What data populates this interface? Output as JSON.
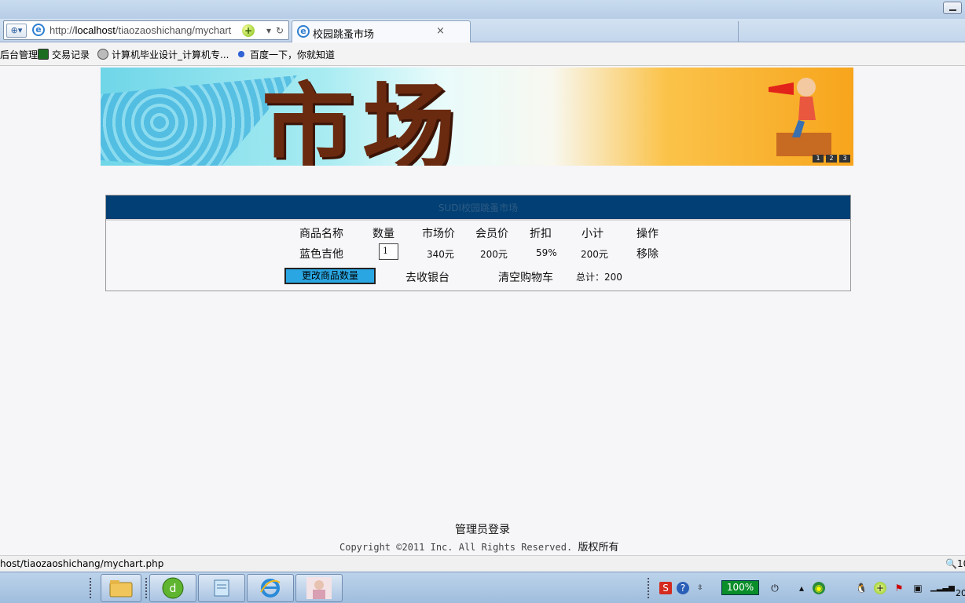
{
  "browser": {
    "url_prefix": "http://",
    "url_host": "localhost",
    "url_path": "/tiaozaoshichang/mychart",
    "tab_title": "校园跳蚤市场",
    "tab_close": "×",
    "favorites": [
      "后台管理",
      "交易记录",
      "计算机毕业设计_计算机专...",
      "百度一下，你就知道"
    ],
    "status_url": "host/tiaozaoshichang/mychart.php",
    "zoom_label": "10"
  },
  "banner": {
    "text": "市场",
    "slides": [
      "1",
      "2",
      "3"
    ]
  },
  "cart": {
    "header": "SUDI校园跳蚤市场",
    "columns": [
      "商品名称",
      "数量",
      "市场价",
      "会员价",
      "折扣",
      "小计",
      "操作"
    ],
    "rows": [
      {
        "name": "蓝色吉他",
        "qty": "1",
        "market_price": "340元",
        "member_price": "200元",
        "discount": "59%",
        "subtotal": "200元",
        "action": "移除"
      }
    ],
    "update_button": "更改商品数量",
    "checkout": "去收银台",
    "clear": "清空购物车",
    "total": "总计：200"
  },
  "footer": {
    "admin_login": "管理员登录",
    "copyright": "Copyright ©2011 Inc. All Rights Reserved.",
    "copyright_cn": "版权所有"
  },
  "taskbar": {
    "battery": "100%",
    "clock": "20"
  }
}
